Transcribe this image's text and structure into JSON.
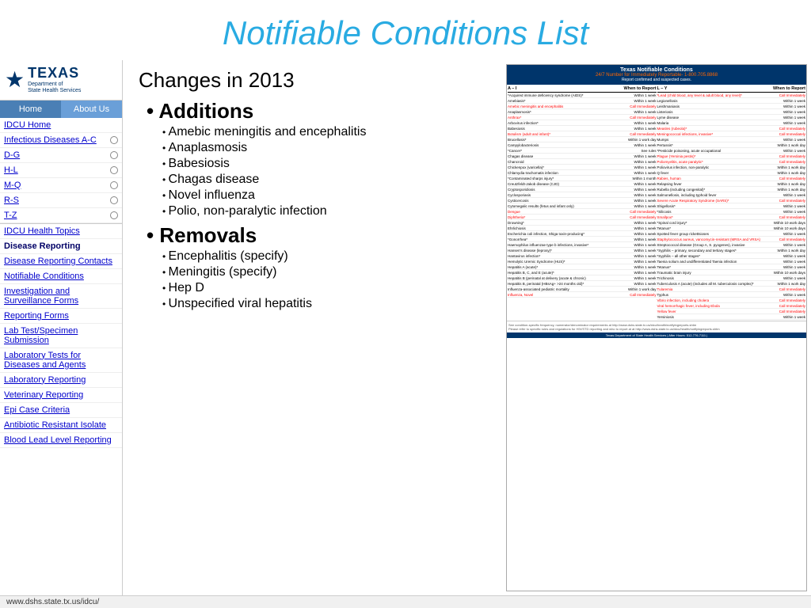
{
  "header": {
    "title": "Notifiable Conditions List"
  },
  "nav": {
    "items": [
      {
        "label": "Home",
        "active": false
      },
      {
        "label": "About Us",
        "active": true
      }
    ]
  },
  "logo": {
    "texas": "TEXAS",
    "dept_line1": "Department of",
    "dept_line2": "State Health Services"
  },
  "sidebar": {
    "items": [
      {
        "label": "IDCU Home",
        "link": true,
        "circle": false
      },
      {
        "label": "Infectious Diseases A-C",
        "link": true,
        "circle": true
      },
      {
        "label": "D-G",
        "link": true,
        "circle": true
      },
      {
        "label": "H-L",
        "link": true,
        "circle": true
      },
      {
        "label": "M-Q",
        "link": true,
        "circle": true
      },
      {
        "label": "R-S",
        "link": true,
        "circle": true
      },
      {
        "label": "T-Z",
        "link": true,
        "circle": true
      },
      {
        "label": "IDCU Health Topics",
        "link": true,
        "circle": false
      },
      {
        "label": "Disease Reporting",
        "link": true,
        "circle": false,
        "active": true
      },
      {
        "label": "Disease Reporting Contacts",
        "link": true,
        "circle": false
      },
      {
        "label": "Notifiable Conditions",
        "link": true,
        "circle": false,
        "highlighted": true
      },
      {
        "label": "Investigation and Surveillance Forms",
        "link": true,
        "circle": false
      },
      {
        "label": "Reporting Forms",
        "link": true,
        "circle": false
      },
      {
        "label": "Lab Test/Specimen Submission",
        "link": true,
        "circle": false
      },
      {
        "label": "Laboratory Tests for Diseases and Agents",
        "link": true,
        "circle": false
      },
      {
        "label": "Laboratory Reporting",
        "link": true,
        "circle": false
      },
      {
        "label": "Veterinary Reporting",
        "link": true,
        "circle": false
      },
      {
        "label": "Epi Case Criteria",
        "link": true,
        "circle": false
      },
      {
        "label": "Antibiotic Resistant Isolate",
        "link": true,
        "circle": false
      },
      {
        "label": "Blood Lead Level Reporting",
        "link": true,
        "circle": false
      }
    ]
  },
  "content": {
    "changes_title": "Changes in 2013",
    "additions_label": "Additions",
    "additions": [
      "Amebic meningitis and encephalitis",
      "Anaplasmosis",
      "Babesiosis",
      "Chagas disease",
      "Novel influenza",
      "Polio, non-paralytic infection"
    ],
    "removals_label": "Removals",
    "removals": [
      "Encephalitis (specify)",
      "Meningitis (specify)",
      "Hep D",
      "Unspecified viral hepatitis"
    ]
  },
  "card": {
    "title": "Texas Notifiable Conditions",
    "phone_label": "24/7 Number for Immediately Reportable- 1-800.705.8868",
    "report_note": "Report confirmed and suspected cases.",
    "col1_header": "A – I",
    "col1_when": "When to Report",
    "col2_header": "L – Y",
    "col2_when": "When to Report",
    "col1_rows": [
      [
        "*Acquired immune deficiency syndrome (AIDS)*",
        "Within 1 week"
      ],
      [
        "Amebiasis*",
        "Within 1 week"
      ],
      [
        "Amebic meningitis and encephalitis",
        "Call Immediately"
      ],
      [
        "Anaplasmosis*",
        "Within 1 week"
      ],
      [
        "Anthrax*",
        "Call Immediately"
      ],
      [
        "Arbovirus infection*",
        "Within 1 week"
      ],
      [
        "Babesiosis",
        "Within 1 week"
      ],
      [
        "Botulism (adult and infant)*",
        "Call Immediately"
      ],
      [
        "Brucellosis*",
        "Within 1 work day"
      ],
      [
        "Campylobacteriosis",
        "Within 1 week"
      ],
      [
        "*Cancer*",
        "See rules"
      ],
      [
        "Chagas disease",
        "Within 1 week"
      ],
      [
        "Chancroid",
        "Within 1 week"
      ],
      [
        "Chickenpox (varicella)*",
        "Within 1 week"
      ],
      [
        "Chlamydia trachomatis infection",
        "Within 1 week"
      ],
      [
        "*Contaminated sharps injury*",
        "Within 1 month"
      ],
      [
        "Creutzfeldt-Jakob disease (CJD)",
        "Within 1 week"
      ],
      [
        "Cryptosporidiosis",
        "Within 1 week"
      ],
      [
        "Cyclosporiasis",
        "Within 1 week"
      ],
      [
        "Cysticercosis",
        "Within 1 week"
      ],
      [
        "Cytomegalic results (fetus and infant only)",
        "Within 1 week"
      ],
      [
        "Dengue",
        "Call Immediately"
      ],
      [
        "Diphtheria*",
        "Call Immediately"
      ],
      [
        "Drowning*",
        "Within 1 week"
      ],
      [
        "Ehrlichiosis",
        "Within 1 week"
      ],
      [
        "Escherichia coli infection, Shiga toxin-producing*",
        "Within 1 week"
      ],
      [
        "*Gonorrhea*",
        "Within 1 week"
      ],
      [
        "Haemophilus influenzae type b infections, invasive*",
        "Within 1 week"
      ],
      [
        "Hansen's disease (leprosy)*",
        "Within 1 week"
      ],
      [
        "Hantavirus infection*",
        "Within 1 week"
      ],
      [
        "Hemolytic Uremic Syndrome (HUS)*",
        "Within 1 week"
      ],
      [
        "Hepatitis A (acute)*",
        "Within 1 week"
      ],
      [
        "Hepatitis B, C, and E (acute)*",
        "Within 1 week"
      ],
      [
        "Hepatitis B (perinatal at delivery (acute & chronic)",
        "Within 1 week"
      ],
      [
        "Hepatitis B, perinatal (HBsAg+ >24 months old)*",
        "Within 1 week"
      ],
      [
        "Influenza-associated pediatric mortality",
        "Within 1 work day"
      ],
      [
        "Influenza, Novel",
        "Call Immediately"
      ]
    ],
    "col2_rows": [
      [
        "*Lead (child blood, any level & adult blood, any level)*",
        "Call Immediately"
      ],
      [
        "Legionellosis",
        "Within 1 week"
      ],
      [
        "Leishmaniasis",
        "Within 1 week"
      ],
      [
        "Listeriosis",
        "Within 1 week"
      ],
      [
        "Lyme disease",
        "Within 1 week"
      ],
      [
        "Malaria",
        "Within 1 week"
      ],
      [
        "Measles (rubeola)*",
        "Call Immediately"
      ],
      [
        "Meningococcal infections, invasive*",
        "Call Immediately"
      ],
      [
        "Mumps",
        "Within 1 week"
      ],
      [
        "Pertussis*",
        "Within 1 work day"
      ],
      [
        "*Pesticide poisoning, acute occupational",
        "Within 1 week"
      ],
      [
        "Plague (Yersinia pestis)*",
        "Call Immediately"
      ],
      [
        "Poliomyelitis, acute paralytic*",
        "Call Immediately"
      ],
      [
        "Poliovirus infection, non-paralytic",
        "Within 1 work day"
      ],
      [
        "Q fever",
        "Within 1 work day"
      ],
      [
        "Rabies, human",
        "Call Immediately"
      ],
      [
        "Relapsing fever",
        "Within 1 work day"
      ],
      [
        "Rubella (including congenital)*",
        "Within 1 work day"
      ],
      [
        "Salmonellosis, including typhoid fever",
        "Within 1 week"
      ],
      [
        "Severe Acute Respiratory Syndrome (SARS)*",
        "Call Immediately"
      ],
      [
        "Shigellosis*",
        "Within 1 week"
      ],
      [
        "*Silicosis",
        "Within 1 week"
      ],
      [
        "Smallpox*",
        "Call Immediately"
      ],
      [
        "*Spinal cord injury*",
        "Within 10 work days"
      ],
      [
        "Tetanus*",
        "Within 10 work days"
      ],
      [
        "Spotted fever group rickettsioses",
        "Within 1 week"
      ],
      [
        "Staphylococcus aureus, vancomycin-resistant (MRSA and VRSA)",
        "Call Immediately"
      ],
      [
        "Streptococcal disease (Group A, S. pyogenes), invasive",
        "Within 1 week"
      ],
      [
        "*Syphilis – primary, secondary and tertiary stages*",
        "Within 1 work day"
      ],
      [
        "*Syphilis – all other stages*",
        "Within 1 week"
      ],
      [
        "Taenia solium and undifferentiated Taenia infection",
        "Within 1 week"
      ],
      [
        "Tetanus*",
        "Within 1 week"
      ],
      [
        "Traumatic brain injury",
        "Within 10 work days"
      ],
      [
        "Trichinosis",
        "Within 1 week"
      ],
      [
        "Tuberculosis A (acute) (includes all M. tuberculosis complex)*",
        "Within 1 work day"
      ],
      [
        "Tularemia",
        "Call Immediately"
      ],
      [
        "Typhus",
        "Within 1 week"
      ],
      [
        "Vibrio infection, including cholera",
        "Call Immediately"
      ],
      [
        "Viral hemorrhagic fever, including Ebola",
        "Call Immediately"
      ],
      [
        "Yellow fever",
        "Call Immediately"
      ],
      [
        "Yersiniosis",
        "Within 1 week"
      ]
    ]
  },
  "url": "www.dshs.state.tx.us/idcu/"
}
